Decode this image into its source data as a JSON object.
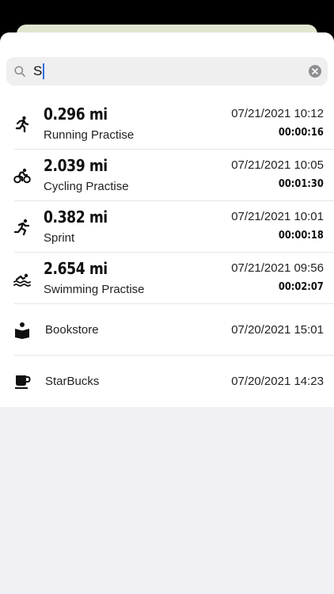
{
  "search": {
    "query": "S",
    "icon": "magnifying-glass-icon",
    "clear_icon": "clear-x-icon"
  },
  "activities": [
    {
      "icon": "running-icon",
      "distance": "0.296 mi",
      "name": "Running Practise",
      "date": "07/21/2021 10:12",
      "duration": "00:00:16"
    },
    {
      "icon": "cycling-icon",
      "distance": "2.039 mi",
      "name": "Cycling Practise",
      "date": "07/21/2021 10:05",
      "duration": "00:01:30"
    },
    {
      "icon": "sprint-icon",
      "distance": "0.382 mi",
      "name": "Sprint",
      "date": "07/21/2021 10:01",
      "duration": "00:00:18"
    },
    {
      "icon": "swimming-icon",
      "distance": "2.654 mi",
      "name": "Swimming Practise",
      "date": "07/21/2021 09:56",
      "duration": "00:02:07"
    }
  ],
  "places": [
    {
      "icon": "book-reader-icon",
      "name": "Bookstore",
      "date": "07/20/2021 15:01"
    },
    {
      "icon": "coffee-cup-icon",
      "name": "StarBucks",
      "date": "07/20/2021 14:23"
    }
  ],
  "colors": {
    "caret": "#2f6fe0",
    "sheet_background": "#f1f1f5",
    "peek_card": "#dfe6cf"
  }
}
